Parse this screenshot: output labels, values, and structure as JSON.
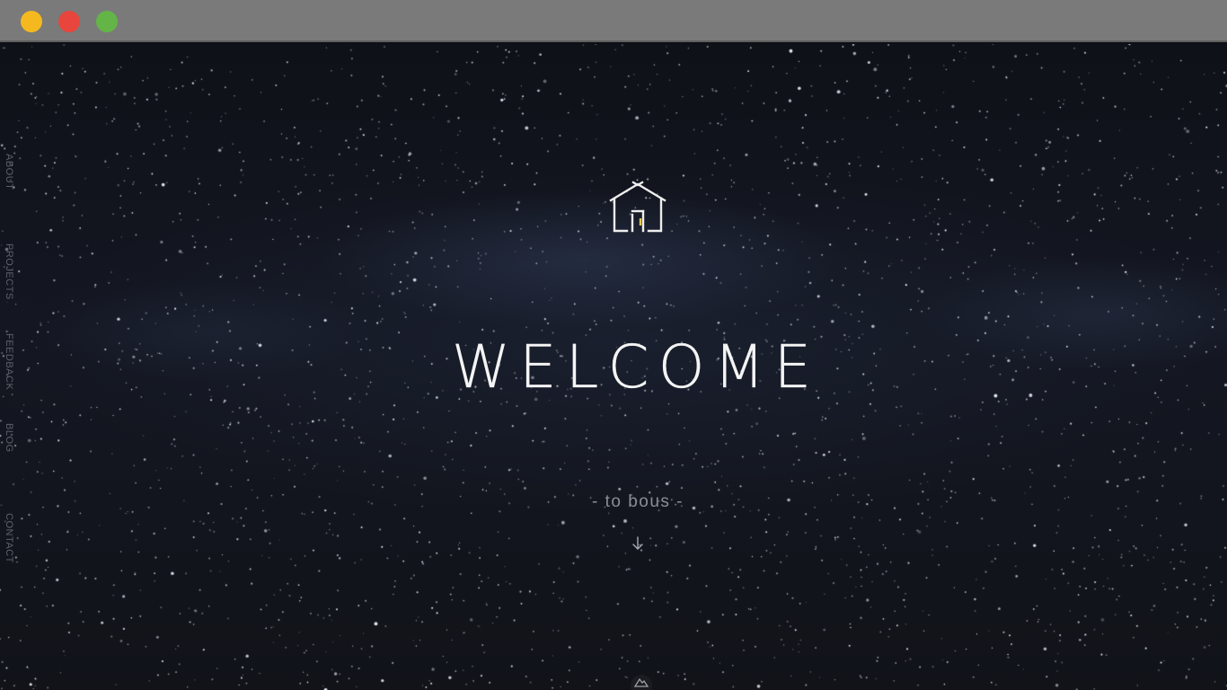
{
  "window": {
    "controls": [
      {
        "name": "minimize",
        "color": "#f5b91f"
      },
      {
        "name": "close",
        "color": "#e8453c"
      },
      {
        "name": "maximize",
        "color": "#63b547"
      }
    ]
  },
  "nav": {
    "items": [
      {
        "label": "ABOUT"
      },
      {
        "label": "PROJECTS"
      },
      {
        "label": "FEEDBACK"
      },
      {
        "label": "BLOG"
      },
      {
        "label": "CONTACT"
      }
    ]
  },
  "hero": {
    "logo_icon": "house-icon",
    "title": "WELCOME",
    "subtitle": "- to bous -",
    "scroll_icon": "arrow-down-icon"
  },
  "footer": {
    "badge_icon": "mountain-icon"
  }
}
